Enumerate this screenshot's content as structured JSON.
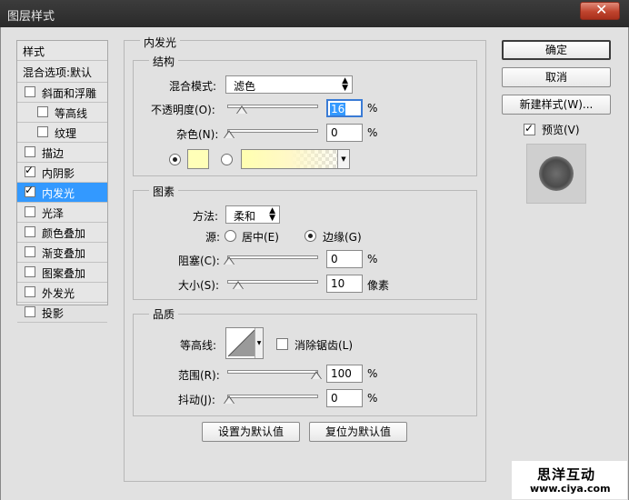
{
  "window": {
    "title": "图层样式"
  },
  "sidebar": {
    "header": "样式",
    "blend_options": "混合选项:默认",
    "items": [
      {
        "label": "斜面和浮雕",
        "checked": false,
        "indent": false
      },
      {
        "label": "等高线",
        "checked": false,
        "indent": true
      },
      {
        "label": "纹理",
        "checked": false,
        "indent": true
      },
      {
        "label": "描边",
        "checked": false,
        "indent": false
      },
      {
        "label": "内阴影",
        "checked": true,
        "indent": false
      },
      {
        "label": "内发光",
        "checked": true,
        "indent": false,
        "selected": true
      },
      {
        "label": "光泽",
        "checked": false,
        "indent": false
      },
      {
        "label": "颜色叠加",
        "checked": false,
        "indent": false
      },
      {
        "label": "渐变叠加",
        "checked": false,
        "indent": false
      },
      {
        "label": "图案叠加",
        "checked": false,
        "indent": false
      },
      {
        "label": "外发光",
        "checked": false,
        "indent": false
      },
      {
        "label": "投影",
        "checked": false,
        "indent": false
      }
    ]
  },
  "main": {
    "title": "内发光",
    "structure": {
      "title": "结构",
      "blend_mode_label": "混合模式:",
      "blend_mode_value": "滤色",
      "opacity_label": "不透明度(O):",
      "opacity_value": "16",
      "opacity_unit": "%",
      "opacity_fraction": 0.16,
      "noise_label": "杂色(N):",
      "noise_value": "0",
      "noise_unit": "%",
      "glow_color": "#ffffb8"
    },
    "elements": {
      "title": "图素",
      "technique_label": "方法:",
      "technique_value": "柔和",
      "source_label": "源:",
      "source_center": "居中(E)",
      "source_edge": "边缘(G)",
      "choke_label": "阻塞(C):",
      "choke_value": "0",
      "choke_unit": "%",
      "size_label": "大小(S):",
      "size_value": "10",
      "size_unit": "像素"
    },
    "quality": {
      "title": "品质",
      "contour_label": "等高线:",
      "antialias_label": "消除锯齿(L)",
      "range_label": "范围(R):",
      "range_value": "100",
      "range_unit": "%",
      "jitter_label": "抖动(J):",
      "jitter_value": "0",
      "jitter_unit": "%"
    },
    "make_default": "设置为默认值",
    "reset_default": "复位为默认值"
  },
  "actions": {
    "ok": "确定",
    "cancel": "取消",
    "new_style": "新建样式(W)...",
    "preview_label": "预览(V)",
    "preview_checked": true
  },
  "watermark": {
    "line1": "思洋互动",
    "line2": "www.ciya.com"
  }
}
